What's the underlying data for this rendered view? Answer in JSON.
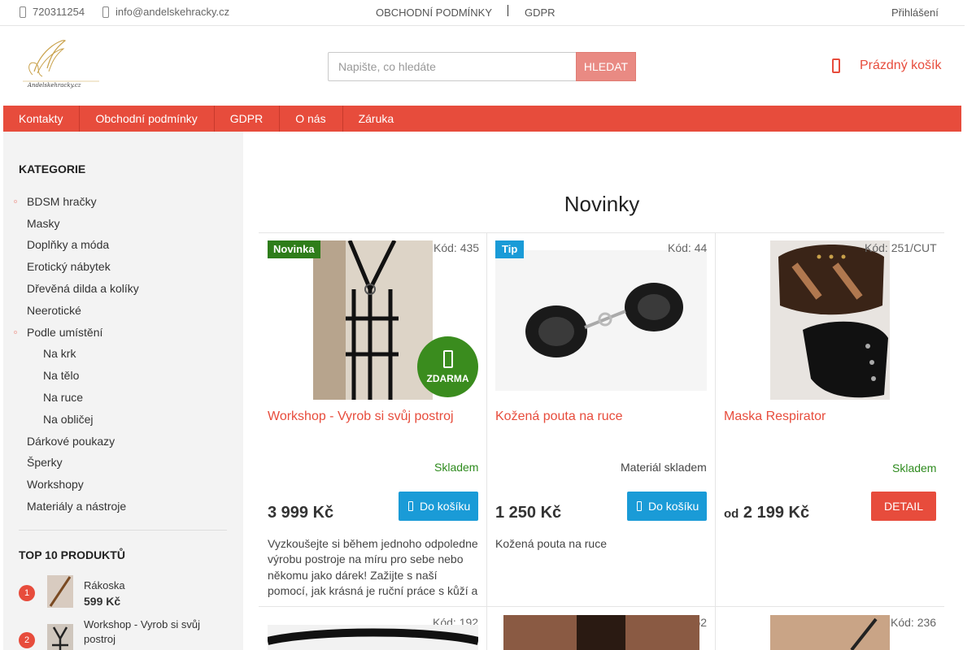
{
  "topbar": {
    "phone": "720311254",
    "email": "info@andelskehracky.cz",
    "terms": "OBCHODNÍ PODMÍNKY",
    "gdpr": "GDPR",
    "login": "Přihlášení"
  },
  "header": {
    "logo_text": "Andelskehracky.cz",
    "search_placeholder": "Napište, co hledáte",
    "search_button": "HLEDAT",
    "cart_label": "Prázdný košík"
  },
  "nav": [
    "Kontakty",
    "Obchodní podmínky",
    "GDPR",
    "O nás",
    "Záruka"
  ],
  "sidebar": {
    "categories_title": "KATEGORIE",
    "categories": [
      {
        "label": "BDSM hračky"
      },
      {
        "label": "Masky"
      },
      {
        "label": "Doplňky a móda"
      },
      {
        "label": "Erotický nábytek"
      },
      {
        "label": "Dřevěná dilda a kolíky"
      },
      {
        "label": "Neerotické"
      },
      {
        "label": "Podle umístění"
      },
      {
        "label": "Na krk"
      },
      {
        "label": "Na tělo"
      },
      {
        "label": "Na ruce"
      },
      {
        "label": "Na obličej"
      },
      {
        "label": "Dárkové poukazy"
      },
      {
        "label": "Šperky"
      },
      {
        "label": "Workshopy"
      },
      {
        "label": "Materiály a nástroje"
      }
    ],
    "top_title": "TOP 10 PRODUKTŮ",
    "top": [
      {
        "rank": "1",
        "name": "Rákoska",
        "price": "599 Kč"
      },
      {
        "rank": "2",
        "name": "Workshop - Vyrob si svůj postroj",
        "price": ""
      }
    ]
  },
  "main": {
    "heading": "Novinky",
    "products": [
      {
        "badge": "Novinka",
        "code": "Kód: 435",
        "name": "Workshop - Vyrob si svůj postroj",
        "stock": "Skladem",
        "price": "3 999 Kč",
        "price_prefix": "",
        "button": "Do košíku",
        "free_label": "ZDARMA",
        "description": "Vyzkoušejte si během jednoho odpoledne výrobu postroje na míru pro sebe nebo někomu jako dárek! Zažijte s naší pomocí, jak krásná je ruční práce s kůží a"
      },
      {
        "badge": "Tip",
        "code": "Kód: 44",
        "name": "Kožená pouta na ruce",
        "stock": "Materiál skladem",
        "price": "1 250 Kč",
        "price_prefix": "",
        "button": "Do košíku",
        "description": "Kožená pouta na ruce"
      },
      {
        "badge": "",
        "code": "Kód: 251/CUT",
        "name": "Maska Respirator",
        "stock": "Skladem",
        "price": "2 199 Kč",
        "price_prefix": "od",
        "button": "DETAIL",
        "description": ""
      }
    ],
    "next_codes": [
      "Kód: 192",
      "Kód: 352",
      "Kód: 236"
    ]
  },
  "colors": {
    "accent": "#e74c3c",
    "cart_button": "#1a9bd7",
    "stock_green": "#2e8b1e",
    "badge_new": "#2e7d1a",
    "free_circle": "#3a8c1e"
  }
}
